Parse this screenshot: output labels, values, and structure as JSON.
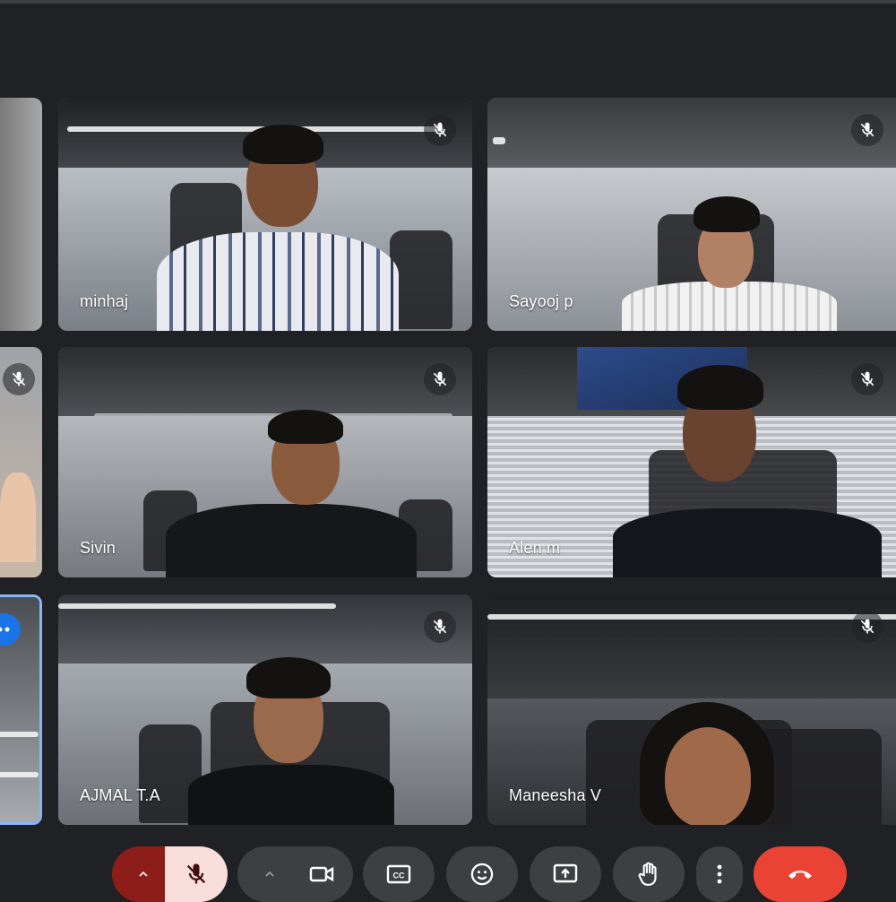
{
  "participants": [
    {
      "name": "",
      "mic": "on",
      "selected": false
    },
    {
      "name": "minhaj",
      "mic": "muted"
    },
    {
      "name": "Sayooj p",
      "mic": "muted"
    },
    {
      "name": "",
      "mic": "muted"
    },
    {
      "name": "Sivin",
      "mic": "muted"
    },
    {
      "name": "Alen m",
      "mic": "muted"
    },
    {
      "name": "",
      "mic": "on",
      "selected": true
    },
    {
      "name": "AJMAL T.A",
      "mic": "muted"
    },
    {
      "name": "Maneesha V",
      "mic": "muted"
    }
  ],
  "controls": {
    "mic_state": "muted",
    "buttons": [
      "audio-options",
      "microphone",
      "video-options",
      "camera",
      "captions",
      "reactions",
      "present-screen",
      "raise-hand",
      "more-options",
      "leave-call"
    ]
  },
  "colors": {
    "background": "#202124",
    "accent": "#1a73e8",
    "mic_muted_bg": "#f9dedc",
    "mic_muted_icon": "#b3261e",
    "leave": "#ea4335"
  }
}
